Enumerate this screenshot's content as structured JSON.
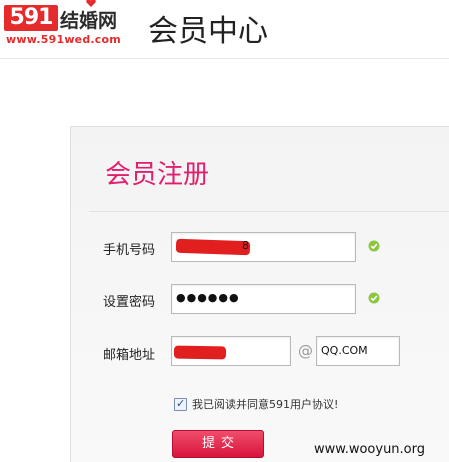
{
  "brand": {
    "logo_number": "591",
    "logo_text": "结婚网",
    "logo_url": "www.591wed.com",
    "brand_color": "#e52b2b"
  },
  "header": {
    "title": "会员中心"
  },
  "form": {
    "title": "会员注册",
    "title_color": "#e0206f",
    "phone": {
      "label": "手机号码",
      "value_visible": "8",
      "status_icon": "check-circle-icon"
    },
    "password": {
      "label": "设置密码",
      "masked_value": "●●●●●●",
      "status_icon": "check-circle-icon"
    },
    "email": {
      "label": "邮箱地址",
      "at_symbol": "@",
      "domain_value": "QQ.COM"
    },
    "agreement": {
      "checked": true,
      "text": "我已阅读并同意591用户协议!"
    },
    "submit_label": "提交",
    "submit_color": "#e21a45",
    "redaction_color": "#e21f1f"
  },
  "watermark": "www.wooyun.org"
}
